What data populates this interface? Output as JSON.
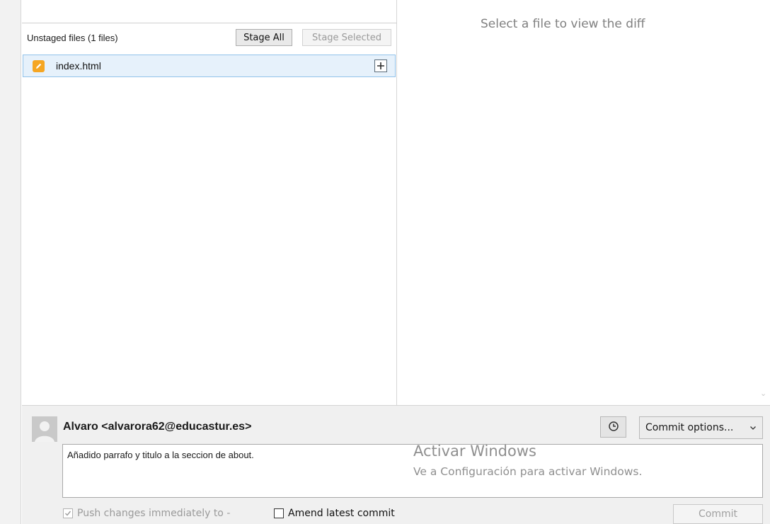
{
  "unstaged": {
    "title": "Unstaged files  (1 files)",
    "stage_all_label": "Stage All",
    "stage_selected_label": "Stage Selected",
    "files": [
      {
        "name": "index.html",
        "status_icon": "pencil-modified-icon"
      }
    ]
  },
  "diff": {
    "placeholder": "Select a file to view the diff"
  },
  "commit": {
    "author": "Alvaro <alvarora62@educastur.es>",
    "history_icon": "clock-icon",
    "options_label": "Commit options...",
    "message": "Añadido parrafo y titulo a la seccion de about.",
    "push_label": "Push changes immediately to -",
    "push_checked": true,
    "amend_label": "Amend latest commit",
    "amend_checked": false,
    "commit_button_label": "Commit"
  },
  "watermark": {
    "title": "Activar Windows",
    "subtitle": "Ve a Configuración para activar Windows."
  },
  "colors": {
    "selected_row": "#e6f1fb",
    "selected_border": "#91c2ea",
    "modified_icon": "#f5a623"
  }
}
